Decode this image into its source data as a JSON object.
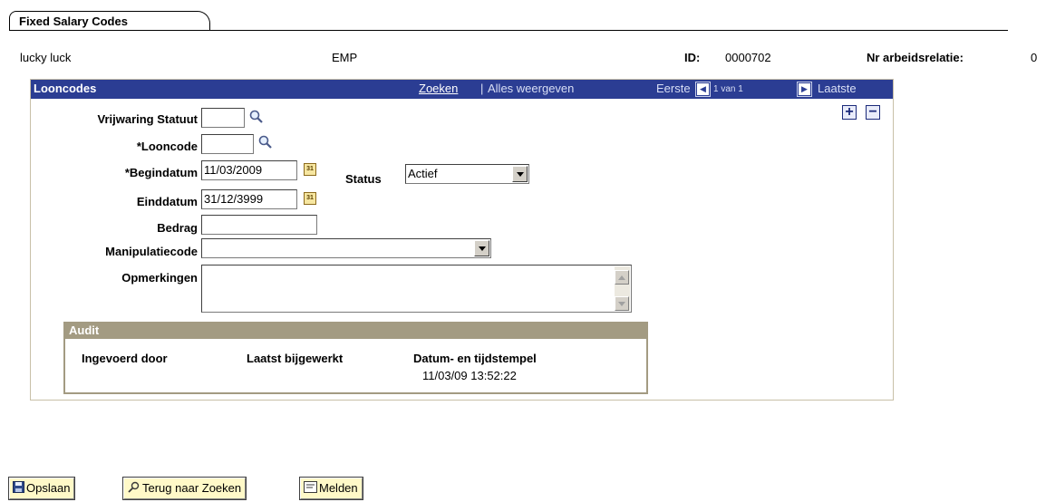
{
  "tab": {
    "label": "Fixed Salary Codes"
  },
  "header": {
    "name": "lucky luck",
    "type": "EMP",
    "id_label": "ID:",
    "id_value": "0000702",
    "relation_label": "Nr arbeidsrelatie:",
    "relation_value": "0"
  },
  "panel": {
    "title": "Looncodes",
    "search_link": "Zoeken",
    "separator": "|",
    "show_all": "Alles weergeven",
    "first": "Eerste",
    "position": "1 van 1",
    "last": "Laatste",
    "add_symbol": "+",
    "remove_symbol": "−"
  },
  "form": {
    "vrijwaring_label": "Vrijwaring Statuut",
    "vrijwaring_value": "",
    "looncode_label": "*Looncode",
    "looncode_value": "",
    "begindatum_label": "*Begindatum",
    "begindatum_value": "11/03/2009",
    "status_label": "Status",
    "status_value": "Actief",
    "einddatum_label": "Einddatum",
    "einddatum_value": "31/12/3999",
    "bedrag_label": "Bedrag",
    "bedrag_value": "",
    "manipulatie_label": "Manipulatiecode",
    "manipulatie_value": "",
    "opmerkingen_label": "Opmerkingen",
    "opmerkingen_value": "",
    "cal_text": "31"
  },
  "audit": {
    "title": "Audit",
    "col1": "Ingevoerd door",
    "col2": "Laatst bijgewerkt",
    "col3": "Datum- en tijdstempel",
    "timestamp": "11/03/09 13:52:22"
  },
  "buttons": {
    "save": "Opslaan",
    "back": "Terug naar Zoeken",
    "notify": "Melden"
  },
  "icons": {
    "lookup": "magnifier-icon",
    "calendar": "calendar-icon",
    "save": "floppy-disk-icon",
    "back": "search-back-icon",
    "notify": "notify-icon"
  },
  "colors": {
    "panel_header": "#2b3d93",
    "audit_header": "#a39b82",
    "button_bg": "#fff9c8"
  }
}
